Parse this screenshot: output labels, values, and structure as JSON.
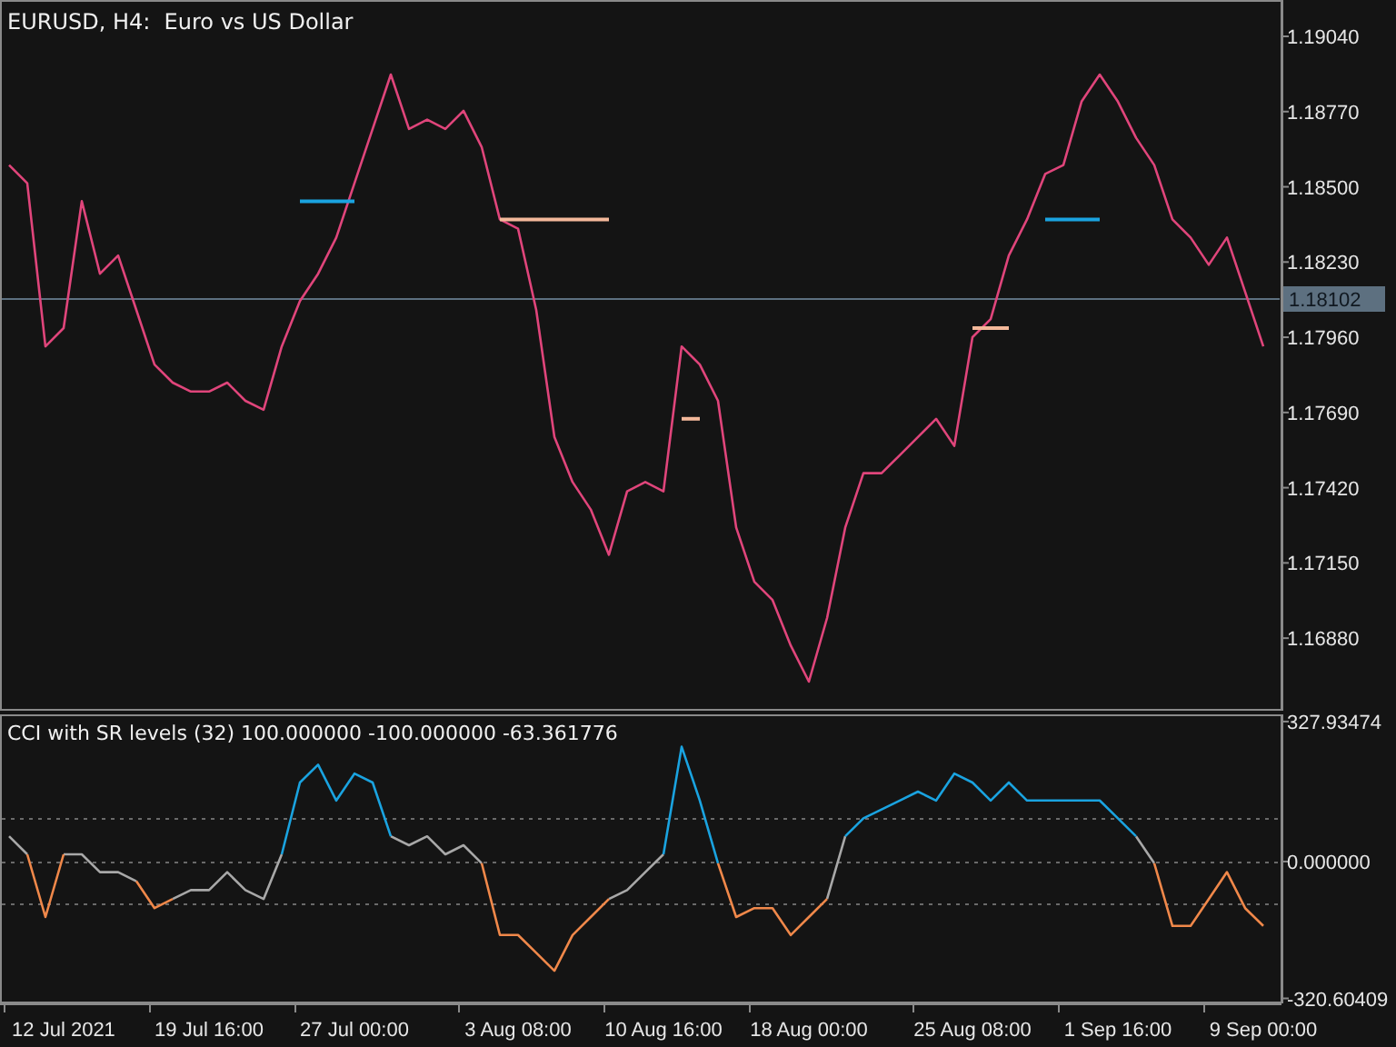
{
  "price_panel": {
    "chart_data": {
      "type": "line",
      "title": "EURUSD, H4:  Euro vs US Dollar",
      "series": [
        {
          "color": "#e0457b",
          "values": [
            1.18578,
            1.18513,
            1.17927,
            1.17993,
            1.18448,
            1.18188,
            1.18253,
            1.18058,
            1.17862,
            1.17797,
            1.17765,
            1.17765,
            1.17797,
            1.17732,
            1.177,
            1.17927,
            1.1809,
            1.18188,
            1.18318,
            1.18513,
            1.18708,
            1.18903,
            1.18708,
            1.18741,
            1.18708,
            1.18773,
            1.18643,
            1.18383,
            1.1835,
            1.18058,
            1.17602,
            1.1744,
            1.17342,
            1.17179,
            1.17407,
            1.1744,
            1.17407,
            1.17927,
            1.17862,
            1.17732,
            1.17277,
            1.17082,
            1.17017,
            1.16854,
            1.16724,
            1.16952,
            1.17277,
            1.17472,
            1.17472,
            1.17537,
            1.17602,
            1.17667,
            1.1757,
            1.1796,
            1.18025,
            1.18253,
            1.18383,
            1.18546,
            1.18578,
            1.18806,
            1.18903,
            1.18806,
            1.18676,
            1.18578,
            1.18383,
            1.18318,
            1.1822,
            1.18318,
            1.18123,
            1.17927
          ]
        },
        {
          "color": "#1aa3e0",
          "values": [
            null,
            null,
            null,
            null,
            null,
            null,
            null,
            null,
            null,
            null,
            null,
            null,
            null,
            null,
            null,
            null,
            1.18448,
            1.18448,
            1.18448,
            1.18448,
            null,
            null,
            null,
            null,
            null,
            null,
            null,
            null,
            null,
            null,
            null,
            null,
            null,
            null,
            null,
            null,
            null,
            null,
            null,
            null,
            null,
            null,
            null,
            null,
            null,
            null,
            null,
            null,
            null,
            null,
            null,
            null,
            null,
            null,
            null,
            null,
            null,
            null,
            null,
            null,
            null,
            null,
            null,
            null,
            null,
            null,
            null,
            null,
            null,
            null
          ]
        },
        {
          "color": "#f3b89a",
          "values": [
            null,
            null,
            null,
            null,
            null,
            null,
            null,
            null,
            null,
            null,
            null,
            null,
            null,
            null,
            null,
            null,
            null,
            null,
            null,
            null,
            null,
            null,
            null,
            null,
            null,
            null,
            null,
            1.18383,
            1.18383,
            1.18383,
            1.18383,
            1.18383,
            1.18383,
            1.18383,
            null,
            null,
            null,
            null,
            null,
            null,
            null,
            null,
            null,
            null,
            null,
            null,
            null,
            null,
            null,
            null,
            null,
            null,
            null,
            null,
            null,
            null,
            null,
            null,
            null,
            null,
            null,
            null,
            null,
            null,
            null,
            null,
            null,
            null,
            null,
            null
          ]
        },
        {
          "color": "#1aa3e0",
          "values": [
            null,
            null,
            null,
            null,
            null,
            null,
            null,
            null,
            null,
            null,
            null,
            null,
            null,
            null,
            null,
            null,
            null,
            null,
            null,
            null,
            null,
            null,
            null,
            null,
            null,
            null,
            null,
            null,
            null,
            null,
            null,
            null,
            null,
            null,
            null,
            null,
            null,
            null,
            null,
            null,
            null,
            null,
            null,
            null,
            null,
            null,
            null,
            null,
            null,
            null,
            null,
            null,
            null,
            null,
            null,
            null,
            null,
            1.18383,
            1.18383,
            1.18383,
            1.18383,
            null,
            null,
            null,
            null,
            null,
            null,
            null,
            null,
            null
          ]
        },
        {
          "color": "#f3b89a",
          "values": [
            null,
            null,
            null,
            null,
            null,
            null,
            null,
            null,
            null,
            null,
            null,
            null,
            null,
            null,
            null,
            null,
            null,
            null,
            null,
            null,
            null,
            null,
            null,
            null,
            null,
            null,
            null,
            null,
            null,
            null,
            null,
            null,
            null,
            null,
            null,
            null,
            null,
            1.17667,
            1.17667,
            null,
            null,
            null,
            null,
            null,
            null,
            null,
            null,
            null,
            null,
            null,
            null,
            null,
            null,
            null,
            null,
            null,
            null,
            null,
            null,
            null,
            null,
            null,
            null,
            null,
            null,
            null,
            null,
            null,
            null,
            null
          ]
        },
        {
          "color": "#f3b89a",
          "values": [
            null,
            null,
            null,
            null,
            null,
            null,
            null,
            null,
            null,
            null,
            null,
            null,
            null,
            null,
            null,
            null,
            null,
            null,
            null,
            null,
            null,
            null,
            null,
            null,
            null,
            null,
            null,
            null,
            null,
            null,
            null,
            null,
            null,
            null,
            null,
            null,
            null,
            null,
            null,
            null,
            null,
            null,
            null,
            null,
            null,
            null,
            null,
            null,
            null,
            null,
            null,
            null,
            null,
            1.17993,
            1.17993,
            1.17993,
            null,
            null,
            null,
            null,
            null,
            null,
            null,
            null,
            null,
            null,
            null,
            null,
            null,
            null
          ]
        }
      ],
      "ylim": [
        1.16626,
        1.19164
      ],
      "yticks": [
        {
          "value": 1.1904,
          "label": "1.19040"
        },
        {
          "value": 1.1877,
          "label": "1.18770"
        },
        {
          "value": 1.185,
          "label": "1.18500"
        },
        {
          "value": 1.1823,
          "label": "1.18230"
        },
        {
          "value": 1.1796,
          "label": "1.17960"
        },
        {
          "value": 1.1769,
          "label": "1.17690"
        },
        {
          "value": 1.1742,
          "label": "1.17420"
        },
        {
          "value": 1.1715,
          "label": "1.17150"
        },
        {
          "value": 1.1688,
          "label": "1.16880"
        }
      ],
      "ref_lines": [
        {
          "axis": "y",
          "value": 1.18102,
          "label": "1.18102"
        }
      ]
    }
  },
  "cci_panel": {
    "chart_data": {
      "type": "line",
      "title": "CCI with SR levels (32) 100.000000 -100.000000 -63.361776",
      "categories": [
        null,
        null,
        null,
        "12 Jul 2021",
        null,
        null,
        null,
        null,
        null,
        null,
        null,
        "19 Jul 16:00",
        null,
        null,
        null,
        null,
        null,
        null,
        null,
        "27 Jul 00:00",
        null,
        null,
        null,
        null,
        null,
        null,
        null,
        null,
        "3 Aug 08:00",
        null,
        null,
        null,
        null,
        null,
        null,
        null,
        "10 Aug 16:00",
        null,
        null,
        null,
        null,
        null,
        null,
        null,
        "18 Aug 00:00",
        null,
        null,
        null,
        null,
        null,
        null,
        null,
        null,
        "25 Aug 08:00",
        null,
        null,
        null,
        null,
        null,
        null,
        null,
        "1 Sep 16:00",
        null,
        null,
        null,
        null,
        null,
        null,
        null,
        "9 Sep 00:00"
      ],
      "series": [
        {
          "color": "#a8a8a8",
          "values": [
            59,
            17,
            null,
            17,
            17,
            -25,
            -25,
            -46,
            null,
            -88,
            -67,
            -67,
            -25,
            -67,
            -88,
            17,
            null,
            null,
            null,
            null,
            null,
            59,
            38,
            59,
            17,
            38,
            -4,
            null,
            null,
            null,
            null,
            null,
            null,
            -88,
            -67,
            -25,
            17,
            null,
            null,
            null,
            null,
            null,
            null,
            null,
            null,
            -88,
            59,
            null,
            null,
            null,
            null,
            null,
            null,
            null,
            null,
            null,
            null,
            null,
            null,
            null,
            null,
            null,
            59,
            -4,
            null,
            null,
            null,
            null,
            null,
            null
          ]
        },
        {
          "color": "#1aa3e0",
          "values": [
            null,
            null,
            null,
            null,
            null,
            null,
            null,
            null,
            null,
            null,
            null,
            null,
            null,
            null,
            null,
            17,
            185,
            227,
            143,
            206,
            185,
            59,
            null,
            null,
            null,
            null,
            null,
            null,
            null,
            null,
            null,
            null,
            null,
            null,
            null,
            null,
            17,
            269,
            143,
            -4,
            null,
            null,
            null,
            null,
            null,
            null,
            59,
            101,
            122,
            143,
            164,
            143,
            206,
            185,
            143,
            185,
            143,
            143,
            143,
            143,
            143,
            101,
            59,
            null,
            null,
            null,
            null,
            null,
            null,
            null
          ]
        },
        {
          "color": "#f0884a",
          "values": [
            null,
            17,
            -130,
            17,
            null,
            null,
            null,
            -46,
            -109,
            -88,
            null,
            null,
            null,
            null,
            null,
            null,
            null,
            null,
            null,
            null,
            null,
            null,
            null,
            null,
            null,
            null,
            -4,
            -172,
            -172,
            -214,
            -256,
            -172,
            -130,
            -88,
            null,
            null,
            null,
            null,
            null,
            -4,
            -130,
            -109,
            -109,
            -172,
            -130,
            -88,
            null,
            null,
            null,
            null,
            null,
            null,
            null,
            null,
            null,
            null,
            null,
            null,
            null,
            null,
            null,
            null,
            null,
            -4,
            -151,
            -151,
            -88,
            -25,
            -109,
            -151
          ]
        }
      ],
      "ylim": [
        -328,
        340.5
      ],
      "yticks": [
        {
          "value": 327.934743,
          "label": "327.93474"
        },
        {
          "value": 0,
          "label": "0.000000"
        },
        {
          "value": -320.60409,
          "label": "-320.60409"
        }
      ],
      "ref_lines": [
        {
          "axis": "y",
          "value": 100
        },
        {
          "axis": "y",
          "value": 0
        },
        {
          "axis": "y",
          "value": -100
        }
      ]
    }
  }
}
